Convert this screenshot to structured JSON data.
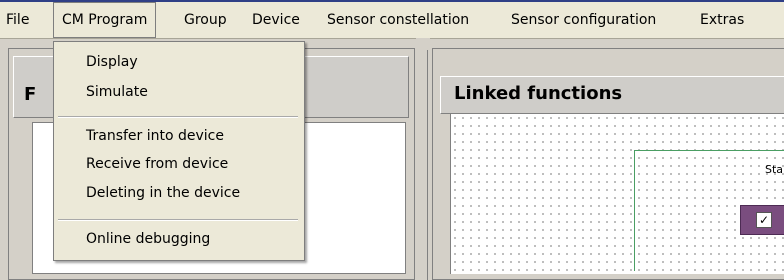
{
  "menubar": {
    "items": [
      "File",
      "CM Program",
      "Group",
      "Device",
      "Sensor constellation",
      "Sensor configuration",
      "Extras"
    ]
  },
  "left_panel": {
    "title": "F"
  },
  "right_panel": {
    "title": "Linked functions",
    "block_label": "Start",
    "checkbox_mark": "✓"
  },
  "dropdown": {
    "items": [
      "Display",
      "Simulate",
      "Transfer into device",
      "Receive from device",
      "Deleting in the device",
      "Online debugging"
    ]
  }
}
